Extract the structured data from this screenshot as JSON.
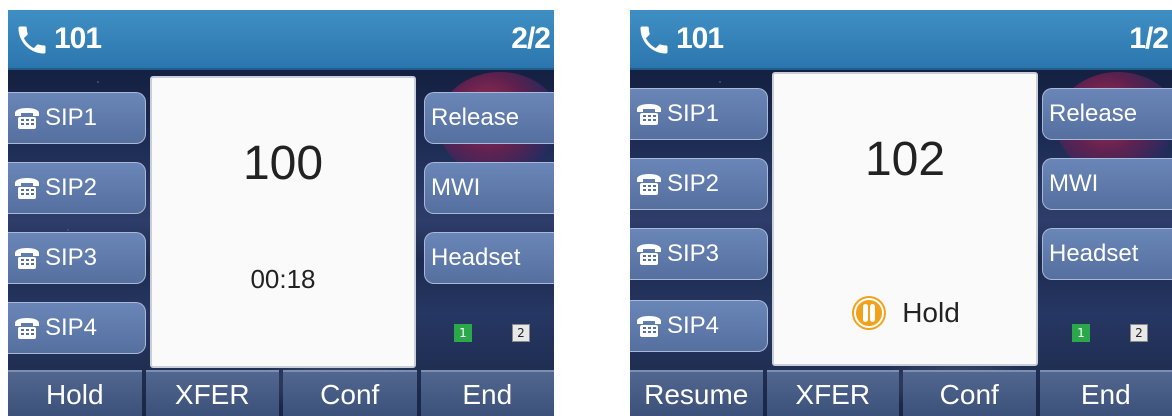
{
  "screens": [
    {
      "header": {
        "line": "101",
        "page": "2/2"
      },
      "left_keys": [
        "SIP1",
        "SIP2",
        "SIP3",
        "SIP4"
      ],
      "right_keys": [
        "Release",
        "MWI",
        "Headset"
      ],
      "call": {
        "number": "100",
        "duration": "00:18"
      },
      "indicators": [
        "1",
        "2"
      ],
      "softkeys": [
        "Hold",
        "XFER",
        "Conf",
        "End"
      ]
    },
    {
      "header": {
        "line": "101",
        "page": "1/2"
      },
      "left_keys": [
        "SIP1",
        "SIP2",
        "SIP3",
        "SIP4"
      ],
      "right_keys": [
        "Release",
        "MWI",
        "Headset"
      ],
      "call": {
        "number": "102",
        "status": "Hold"
      },
      "indicators": [
        "1",
        "2"
      ],
      "softkeys": [
        "Resume",
        "XFER",
        "Conf",
        "End"
      ]
    }
  ],
  "icons": {
    "header": "phone-handset-icon",
    "line_key": "telephone-icon",
    "hold": "pause-icon"
  },
  "colors": {
    "header": "#2f7fb8",
    "hold_icon": "#f2a11a",
    "indicator_active": "#2aa84a"
  }
}
